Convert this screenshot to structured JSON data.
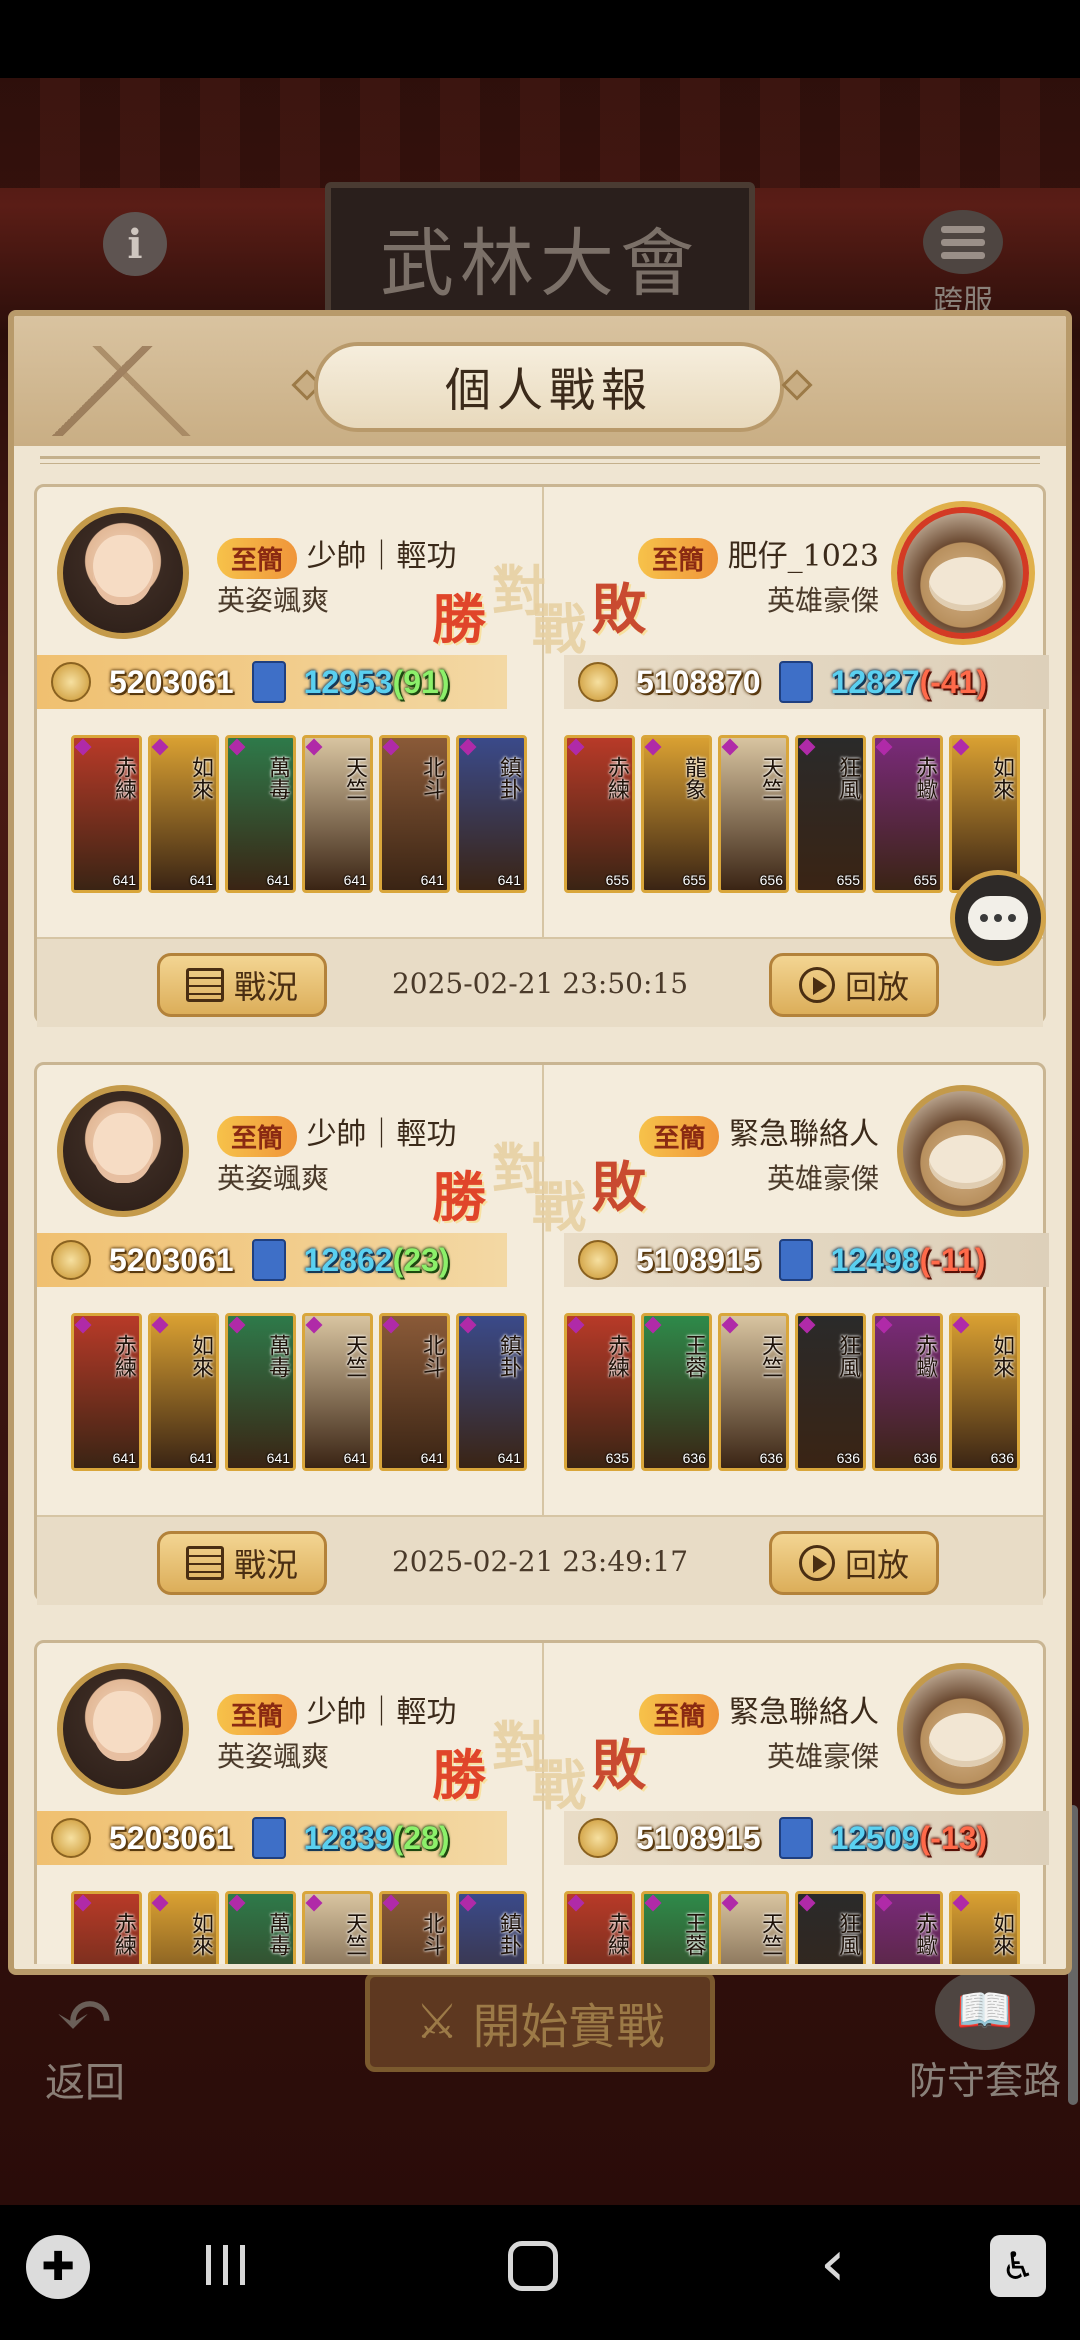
{
  "screen": {
    "title_board": "武林大會",
    "cross_server_label": "跨服",
    "info_icon": "info-icon",
    "back_label": "返回",
    "start_label": "開始實戰",
    "defense_label": "防守套路"
  },
  "panel": {
    "title": "個人戰報"
  },
  "records": [
    {
      "left": {
        "rank": "至簡",
        "name": "少帥｜輕功",
        "subtitle": "英姿颯爽",
        "power": "5203061",
        "score": "12953",
        "delta": "(91)",
        "cards": [
          {
            "glyph": "赤練",
            "level": "641",
            "color": "#b83a28"
          },
          {
            "glyph": "如來",
            "level": "641",
            "color": "#d9a032"
          },
          {
            "glyph": "萬毒",
            "level": "641",
            "color": "#2e7a4a"
          },
          {
            "glyph": "天竺",
            "level": "641",
            "color": "#d8c4a0"
          },
          {
            "glyph": "北斗",
            "level": "641",
            "color": "#8a5a38"
          },
          {
            "glyph": "鎮卦",
            "level": "641",
            "color": "#3a4a8a"
          }
        ]
      },
      "right": {
        "rank": "至簡",
        "name": "肥仔_1023",
        "subtitle": "英雄豪傑",
        "power": "5108870",
        "score": "12827",
        "delta": "(-41)",
        "cards": [
          {
            "glyph": "赤練",
            "level": "655",
            "color": "#b83a28"
          },
          {
            "glyph": "龍象",
            "level": "655",
            "color": "#d9a032"
          },
          {
            "glyph": "天竺",
            "level": "656",
            "color": "#d8c4a0"
          },
          {
            "glyph": "狂風",
            "level": "655",
            "color": "#2a2a2a"
          },
          {
            "glyph": "赤蠍",
            "level": "655",
            "color": "#7a2a7a"
          },
          {
            "glyph": "如來",
            "level": "",
            "color": "#d9a032"
          }
        ]
      },
      "report_label": "戰況",
      "timestamp": "2025-02-21 23:50:15",
      "replay_label": "回放",
      "result": {
        "win": "勝",
        "duel": "對",
        "battle": "戰",
        "lose": "敗"
      }
    },
    {
      "left": {
        "rank": "至簡",
        "name": "少帥｜輕功",
        "subtitle": "英姿颯爽",
        "power": "5203061",
        "score": "12862",
        "delta": "(23)",
        "cards": [
          {
            "glyph": "赤練",
            "level": "641",
            "color": "#b83a28"
          },
          {
            "glyph": "如來",
            "level": "641",
            "color": "#d9a032"
          },
          {
            "glyph": "萬毒",
            "level": "641",
            "color": "#2e7a4a"
          },
          {
            "glyph": "天竺",
            "level": "641",
            "color": "#d8c4a0"
          },
          {
            "glyph": "北斗",
            "level": "641",
            "color": "#8a5a38"
          },
          {
            "glyph": "鎮卦",
            "level": "641",
            "color": "#3a4a8a"
          }
        ]
      },
      "right": {
        "rank": "至簡",
        "name": "緊急聯絡人",
        "subtitle": "英雄豪傑",
        "power": "5108915",
        "score": "12498",
        "delta": "(-11)",
        "cards": [
          {
            "glyph": "赤練",
            "level": "635",
            "color": "#b83a28"
          },
          {
            "glyph": "王蓉",
            "level": "636",
            "color": "#2e8a4a"
          },
          {
            "glyph": "天竺",
            "level": "636",
            "color": "#d8c4a0"
          },
          {
            "glyph": "狂風",
            "level": "636",
            "color": "#2a2a2a"
          },
          {
            "glyph": "赤蠍",
            "level": "636",
            "color": "#7a2a7a"
          },
          {
            "glyph": "如來",
            "level": "636",
            "color": "#d9a032"
          }
        ]
      },
      "report_label": "戰況",
      "timestamp": "2025-02-21 23:49:17",
      "replay_label": "回放",
      "result": {
        "win": "勝",
        "duel": "對",
        "battle": "戰",
        "lose": "敗"
      }
    },
    {
      "left": {
        "rank": "至簡",
        "name": "少帥｜輕功",
        "subtitle": "英姿颯爽",
        "power": "5203061",
        "score": "12839",
        "delta": "(28)",
        "cards": [
          {
            "glyph": "赤練",
            "level": "",
            "color": "#b83a28"
          },
          {
            "glyph": "如來",
            "level": "",
            "color": "#d9a032"
          },
          {
            "glyph": "萬毒",
            "level": "",
            "color": "#2e7a4a"
          },
          {
            "glyph": "天竺",
            "level": "",
            "color": "#d8c4a0"
          },
          {
            "glyph": "北斗",
            "level": "",
            "color": "#8a5a38"
          },
          {
            "glyph": "鎮卦",
            "level": "",
            "color": "#3a4a8a"
          }
        ]
      },
      "right": {
        "rank": "至簡",
        "name": "緊急聯絡人",
        "subtitle": "英雄豪傑",
        "power": "5108915",
        "score": "12509",
        "delta": "(-13)",
        "cards": [
          {
            "glyph": "赤練",
            "level": "",
            "color": "#b83a28"
          },
          {
            "glyph": "王蓉",
            "level": "",
            "color": "#2e8a4a"
          },
          {
            "glyph": "天竺",
            "level": "",
            "color": "#d8c4a0"
          },
          {
            "glyph": "狂風",
            "level": "",
            "color": "#2a2a2a"
          },
          {
            "glyph": "赤蠍",
            "level": "",
            "color": "#7a2a7a"
          },
          {
            "glyph": "如來",
            "level": "",
            "color": "#d9a032"
          }
        ]
      },
      "report_label": "",
      "timestamp": "",
      "replay_label": "",
      "result": {
        "win": "勝",
        "duel": "對",
        "battle": "戰",
        "lose": "敗"
      }
    }
  ],
  "navbar": {
    "game_icon": "gamepad-icon",
    "recent_icon": "recent-apps-icon",
    "home_icon": "home-icon",
    "back_icon": "back-icon",
    "accessibility_icon": "accessibility-icon"
  }
}
